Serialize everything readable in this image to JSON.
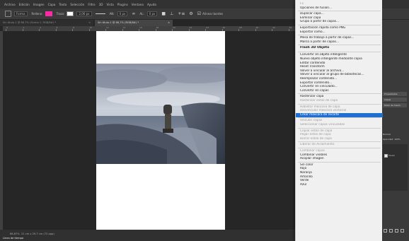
{
  "menubar": {
    "items": [
      "Archivo",
      "Edición",
      "Imagen",
      "Capa",
      "Texto",
      "Selección",
      "Filtro",
      "3D",
      "Vista",
      "Plugins",
      "Ventana",
      "Ayuda"
    ]
  },
  "options_bar": {
    "mode_value": "Forma",
    "fill_label": "Relleno:",
    "stroke_label": "Trazo:",
    "stroke_width": "2,06 px",
    "w_label": "AN:",
    "w_value": "0 px",
    "h_label": "AL:",
    "h_value": "0 px",
    "align_edges_label": "Alinear bordes",
    "colors": {
      "fill": "#ff2aa6",
      "stroke": "#ffffff"
    }
  },
  "tabs": [
    {
      "label": "Sin título-1 @ 66,7% (Forma 1, RGB/8#) *",
      "active": false
    },
    {
      "label": "Sin título-1 @ 66,7% (RGB/8#) *",
      "active": true
    }
  ],
  "ruler": {
    "marks": [
      "0",
      "2",
      "4",
      "6",
      "8",
      "10",
      "12",
      "14",
      "16",
      "18",
      "20",
      "22",
      "24",
      "26",
      "28",
      "30",
      "32",
      "34"
    ]
  },
  "status": {
    "zoom": "66,67%",
    "doc_info": "21 cm x 29,7 cm (72 ppp)",
    "timeline_tab": "Línea de tiempo"
  },
  "right_panel": {
    "buttons": [
      "Propiedades",
      "Capas",
      "Modo de fusión"
    ],
    "rows": [
      "Normal",
      "Opacidad: 100%",
      "Fondo"
    ],
    "icons": [
      "link-icon",
      "fx-icon",
      "mask-icon",
      "folder-icon",
      "new-layer-icon",
      "trash-icon"
    ]
  },
  "context_menu": {
    "highlight_color": "#1f6fd0",
    "items": [
      {
        "label": "Fx",
        "state": "disabled"
      },
      {
        "label": "Opciones de fusión...",
        "state": "enabled"
      },
      {
        "sep": true
      },
      {
        "label": "Duplicar capa...",
        "state": "enabled"
      },
      {
        "label": "Eliminar capa",
        "state": "enabled"
      },
      {
        "label": "Grupo a partir de capas...",
        "state": "enabled"
      },
      {
        "sep": true
      },
      {
        "label": "Exportación rápida como PNG",
        "state": "enabled"
      },
      {
        "label": "Exportar como...",
        "state": "enabled"
      },
      {
        "sep": true
      },
      {
        "label": "Mesa de trabajo a partir de capas...",
        "state": "enabled"
      },
      {
        "label": "Marco a partir de capas...",
        "state": "enabled"
      },
      {
        "sep": true
      },
      {
        "label": "Flash 3D Objeto",
        "state": "bold"
      },
      {
        "sep": true
      },
      {
        "label": "Convertir en objeto inteligente",
        "state": "enabled"
      },
      {
        "label": "Nuevo objeto inteligente mediante copia",
        "state": "enabled"
      },
      {
        "label": "Editar contenido",
        "state": "enabled"
      },
      {
        "label": "Reset Transform",
        "state": "enabled"
      },
      {
        "label": "Volver a vincular al archivo...",
        "state": "enabled"
      },
      {
        "label": "Volver a vincular al grupo de bibliotecas...",
        "state": "enabled"
      },
      {
        "label": "Reemplazar contenido...",
        "state": "enabled"
      },
      {
        "label": "Exportar contenido...",
        "state": "enabled"
      },
      {
        "label": "Convertir en vinculado...",
        "state": "enabled"
      },
      {
        "label": "Convertir en capas",
        "state": "enabled"
      },
      {
        "sep": true
      },
      {
        "label": "Rasterizar capa",
        "state": "enabled"
      },
      {
        "label": "Rasterizar estilo de capa",
        "state": "disabled"
      },
      {
        "sep": true
      },
      {
        "label": "Habilitar máscara de capa",
        "state": "disabled"
      },
      {
        "label": "Desvincular máscara vectorial",
        "state": "disabled"
      },
      {
        "label": "Crear máscara de recorte",
        "state": "highlighted"
      },
      {
        "sep": true
      },
      {
        "label": "Vincular capas",
        "state": "disabled"
      },
      {
        "label": "Seleccionar capas vinculadas",
        "state": "disabled"
      },
      {
        "sep": true
      },
      {
        "label": "Copiar estilo de capa",
        "state": "disabled"
      },
      {
        "label": "Pegar estilo de capa",
        "state": "disabled"
      },
      {
        "label": "Borrar estilo de capa",
        "state": "disabled"
      },
      {
        "sep": true
      },
      {
        "label": "Liberar de Aislamiento",
        "state": "disabled"
      },
      {
        "sep": true
      },
      {
        "label": "Combinar capas",
        "state": "disabled"
      },
      {
        "label": "Combinar visibles",
        "state": "enabled"
      },
      {
        "label": "Acoplar imagen",
        "state": "enabled"
      },
      {
        "sep": true
      },
      {
        "label": "Sin color",
        "state": "enabled"
      },
      {
        "label": "Rojo",
        "state": "enabled"
      },
      {
        "label": "Naranja",
        "state": "enabled"
      },
      {
        "label": "Amarillo",
        "state": "enabled"
      },
      {
        "label": "Verde",
        "state": "enabled"
      },
      {
        "label": "Azul",
        "state": "enabled"
      }
    ]
  }
}
